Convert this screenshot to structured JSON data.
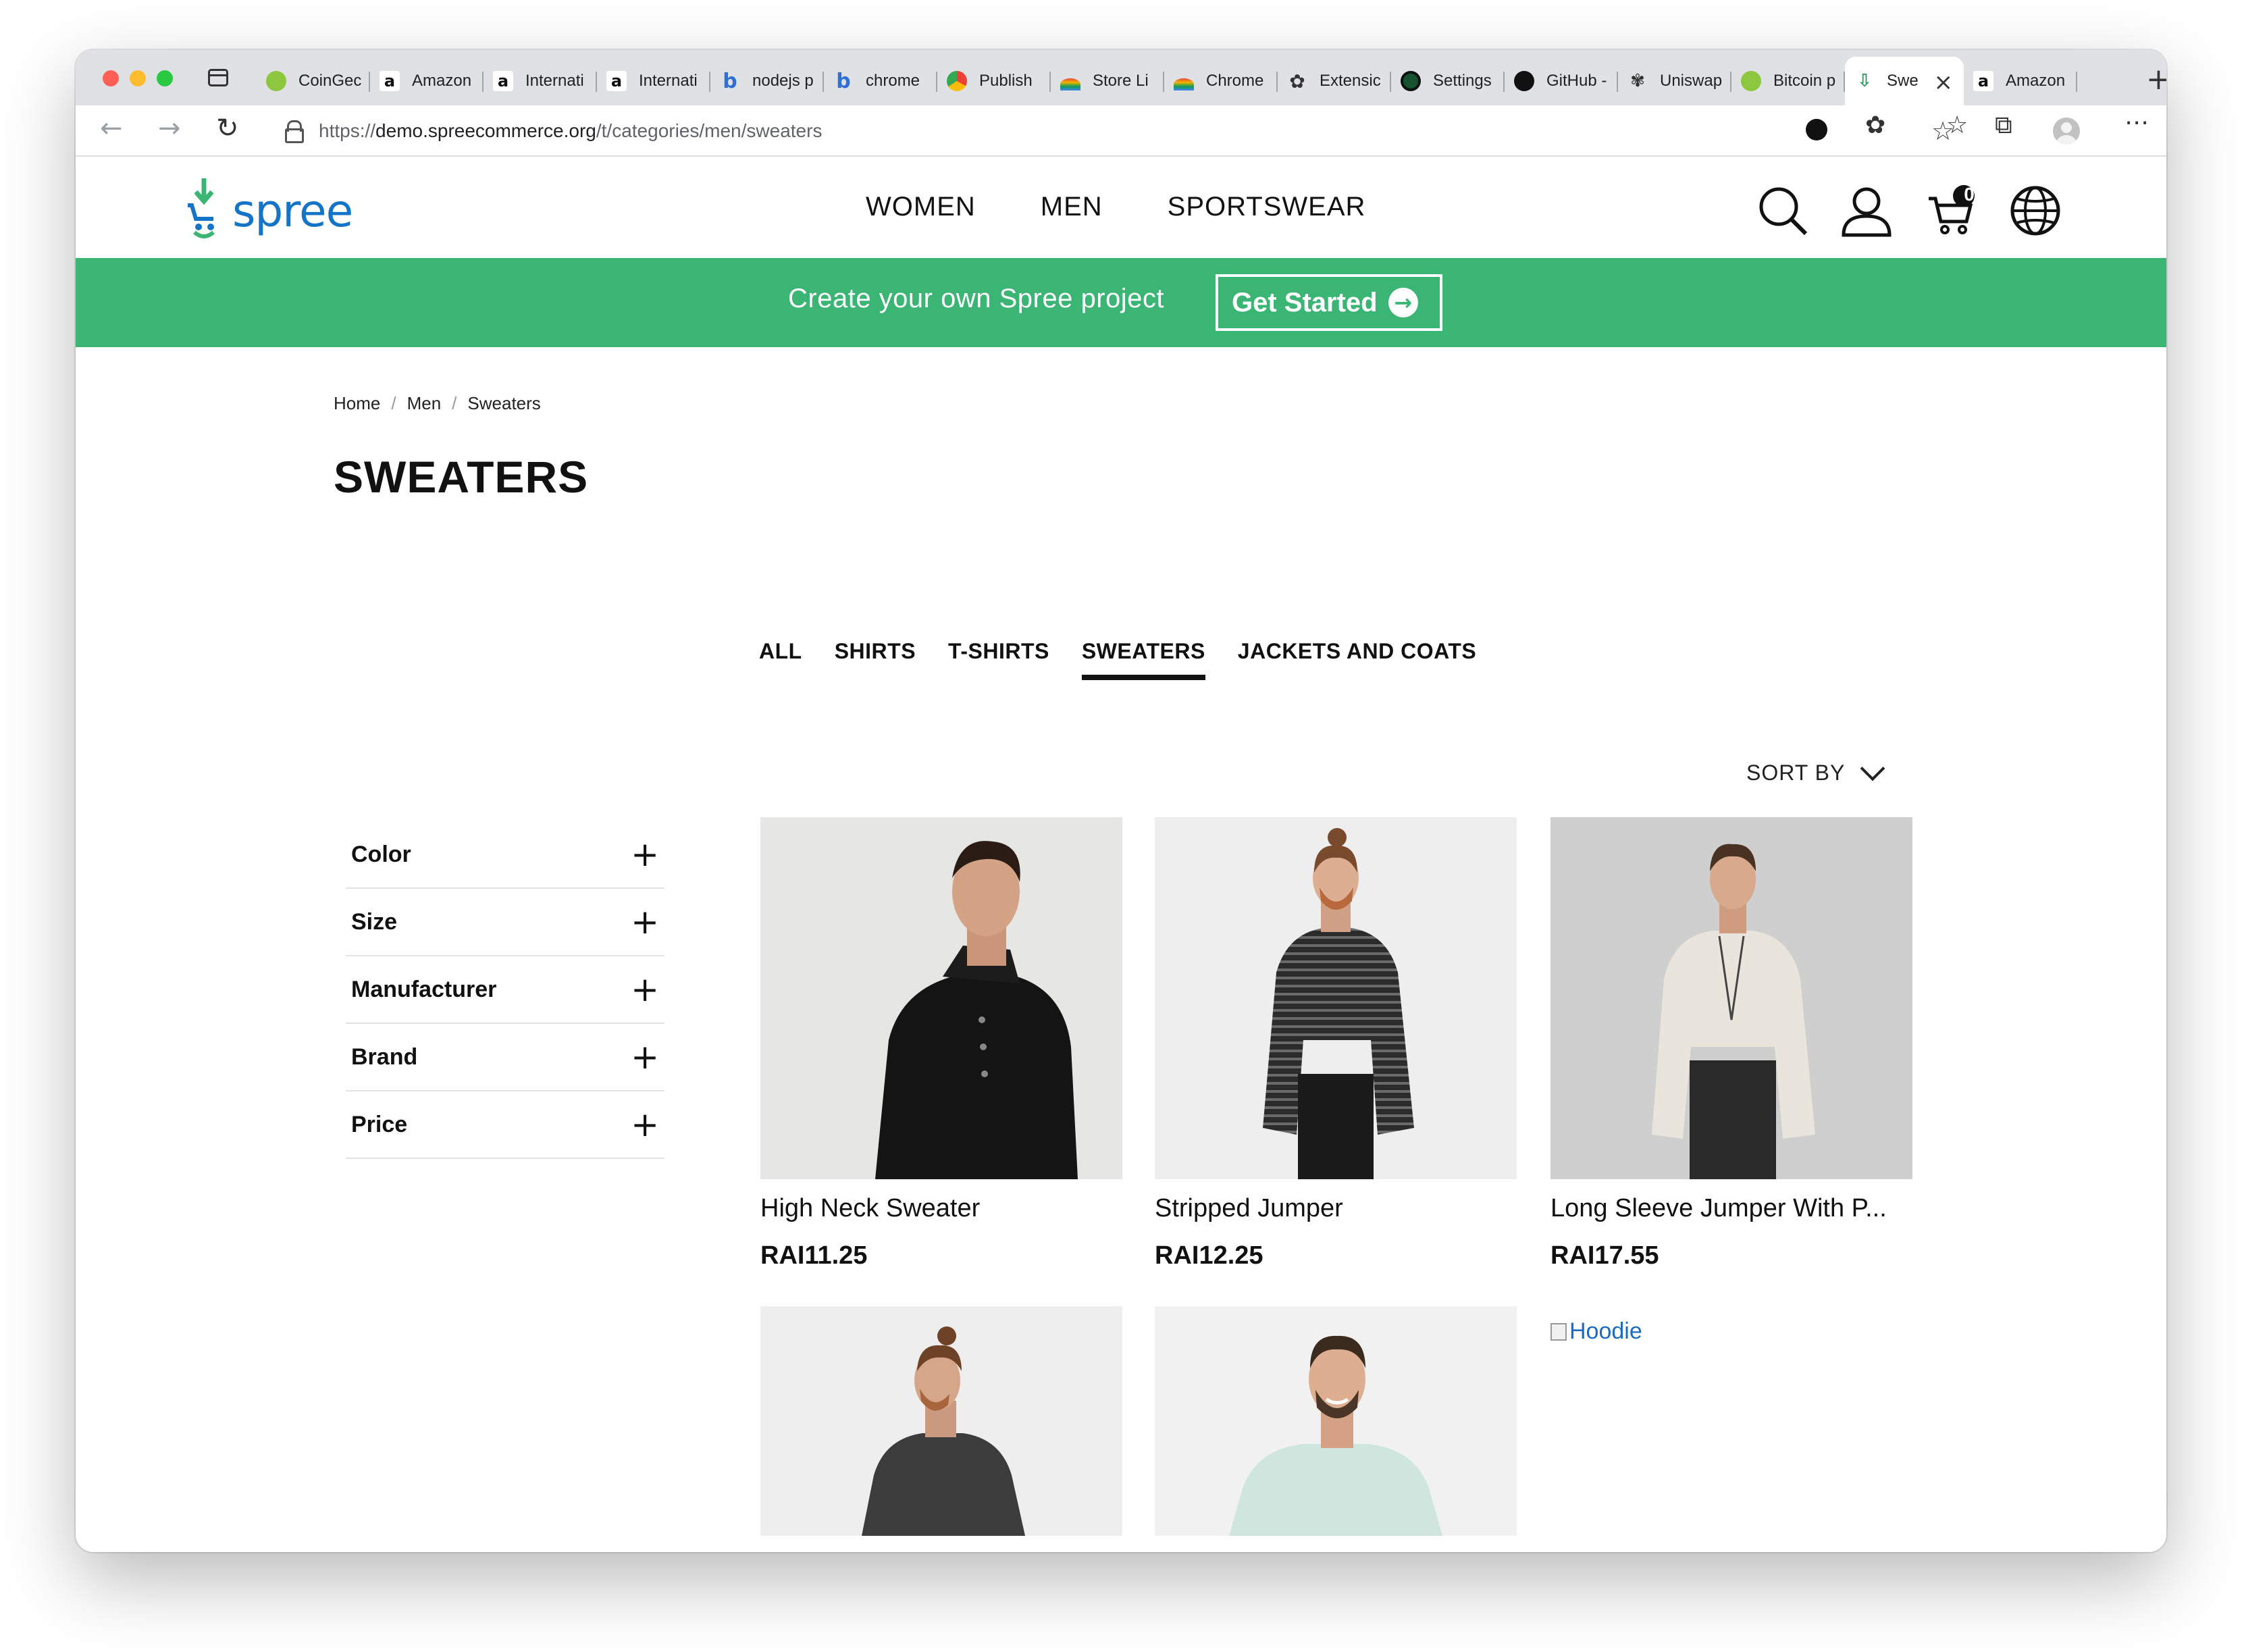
{
  "browser": {
    "tabs": [
      {
        "title": "CoinGec",
        "icon": "coingecko-icon"
      },
      {
        "title": "Amazon",
        "icon": "amazon-icon"
      },
      {
        "title": "Internati",
        "icon": "amazon-icon"
      },
      {
        "title": "Internati",
        "icon": "amazon-icon"
      },
      {
        "title": "nodejs p",
        "icon": "bing-icon"
      },
      {
        "title": "chrome",
        "icon": "bing-icon"
      },
      {
        "title": "Publish",
        "icon": "chrome-icon"
      },
      {
        "title": "Store Li",
        "icon": "rainbow-icon"
      },
      {
        "title": "Chrome",
        "icon": "rainbow-icon"
      },
      {
        "title": "Extensic",
        "icon": "extension-icon"
      },
      {
        "title": "Settings",
        "icon": "settings-icon"
      },
      {
        "title": "GitHub -",
        "icon": "github-icon"
      },
      {
        "title": "Uniswap",
        "icon": "uniswap-icon"
      },
      {
        "title": "Bitcoin p",
        "icon": "coingecko-icon"
      },
      {
        "title": "Swe",
        "icon": "spree-icon",
        "active": true
      },
      {
        "title": "Amazon",
        "icon": "amazon-icon"
      }
    ],
    "url_prefix": "https://",
    "url_host": "demo.spreecommerce.org",
    "url_path": "/t/categories/men/sweaters"
  },
  "header": {
    "logo_text": "spree",
    "nav": [
      "WOMEN",
      "MEN",
      "SPORTSWEAR"
    ],
    "cart_count": "0"
  },
  "promo": {
    "text": "Create your own Spree project",
    "button": "Get Started"
  },
  "breadcrumb": [
    "Home",
    "Men",
    "Sweaters"
  ],
  "page_title": "SWEATERS",
  "subnav": {
    "items": [
      "ALL",
      "SHIRTS",
      "T-SHIRTS",
      "SWEATERS",
      "JACKETS AND COATS"
    ],
    "active": "SWEATERS"
  },
  "sort_label": "SORT BY",
  "filters": [
    "Color",
    "Size",
    "Manufacturer",
    "Brand",
    "Price"
  ],
  "products": [
    {
      "name": "High Neck Sweater",
      "price": "RAI11.25"
    },
    {
      "name": "Stripped Jumper",
      "price": "RAI12.25"
    },
    {
      "name": "Long Sleeve Jumper With P...",
      "price": "RAI17.55"
    },
    {
      "name": "",
      "price": ""
    },
    {
      "name": "",
      "price": ""
    },
    {
      "name": "",
      "price": "",
      "alt": "Hoodie"
    }
  ],
  "colors": {
    "brand_green": "#3ab574",
    "logo_blue": "#1474c8",
    "text": "#111111"
  }
}
